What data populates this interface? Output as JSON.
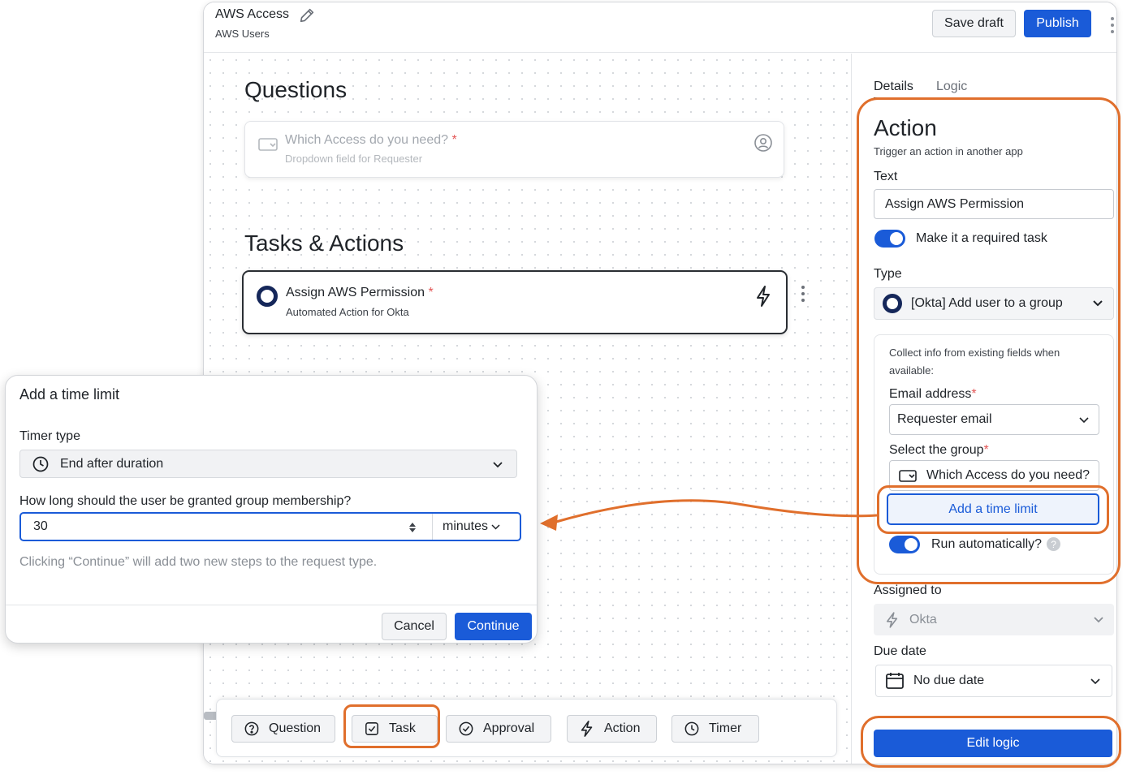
{
  "header": {
    "title": "AWS Access",
    "subtitle": "AWS Users",
    "save_draft": "Save draft",
    "publish": "Publish"
  },
  "canvas": {
    "questions_heading": "Questions",
    "question_card": {
      "title": "Which Access do you need?",
      "required_mark": "*",
      "subtitle": "Dropdown field for Requester"
    },
    "tasks_heading": "Tasks & Actions",
    "task_card": {
      "title": "Assign AWS Permission",
      "required_mark": "*",
      "subtitle": "Automated Action for Okta"
    }
  },
  "toolbar": {
    "question": "Question",
    "task": "Task",
    "approval": "Approval",
    "action": "Action",
    "timer": "Timer"
  },
  "panel": {
    "tabs": [
      "Details",
      "Logic"
    ],
    "active_tab": "Details",
    "heading": "Action",
    "description": "Trigger an action in another app",
    "text_label": "Text",
    "text_value": "Assign AWS Permission",
    "required_toggle_label": "Make it a required task",
    "required_toggle_on": true,
    "type_label": "Type",
    "type_value": "[Okta] Add user to a group",
    "collect_info": "Collect info from existing fields when available:",
    "email_label": "Email address",
    "email_value": "Requester email",
    "group_label": "Select the group",
    "group_value": "Which Access do you need?",
    "add_time_limit": "Add a time limit",
    "run_auto_label": "Run automatically?",
    "run_auto_on": true,
    "assigned_label": "Assigned to",
    "assigned_value": "Okta",
    "due_label": "Due date",
    "due_value": "No due date",
    "edit_logic": "Edit logic",
    "required_mark": "*"
  },
  "modal": {
    "title": "Add a time limit",
    "timer_type_label": "Timer type",
    "timer_type_value": "End after duration",
    "duration_label": "How long should the user be granted group membership?",
    "duration_value": "30",
    "unit_value": "minutes",
    "hint": "Clicking “Continue” will add two new steps to the request type.",
    "cancel": "Cancel",
    "continue": "Continue"
  },
  "colors": {
    "primary": "#1a5bd8",
    "highlight": "#e06f2c",
    "okta": "#15275a",
    "required": "#e35656"
  }
}
